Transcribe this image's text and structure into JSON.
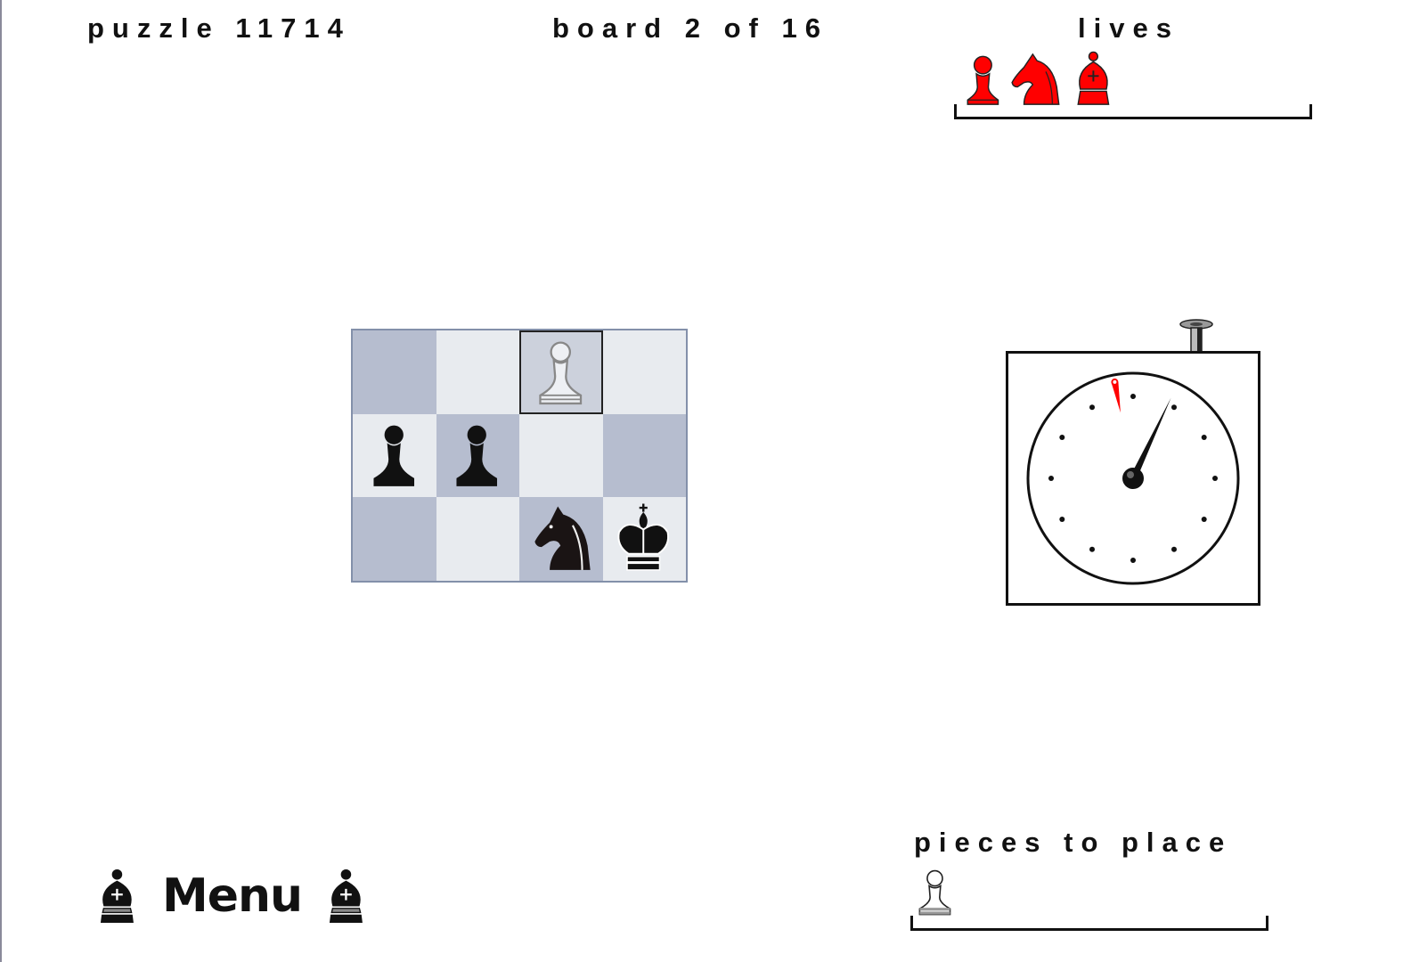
{
  "header": {
    "puzzle_label": "puzzle 11714",
    "board_label": "board 2 of 16",
    "lives_label": "lives"
  },
  "lives": {
    "pieces": [
      "pawn",
      "knight",
      "bishop"
    ],
    "color": "#ff0000"
  },
  "board": {
    "rows": 3,
    "cols": 4,
    "colors": {
      "dark": "#b6bdcf",
      "light": "#e8ebef",
      "border": "#8390aa"
    },
    "selected_square": [
      0,
      2
    ],
    "squares": [
      [
        {
          "shade": "dark",
          "piece": null
        },
        {
          "shade": "light",
          "piece": null
        },
        {
          "shade": "dark",
          "piece": "white-pawn-ghost"
        },
        {
          "shade": "light",
          "piece": null
        }
      ],
      [
        {
          "shade": "light",
          "piece": "black-pawn"
        },
        {
          "shade": "dark",
          "piece": "black-pawn"
        },
        {
          "shade": "light",
          "piece": null
        },
        {
          "shade": "dark",
          "piece": "null"
        }
      ],
      [
        {
          "shade": "dark",
          "piece": null
        },
        {
          "shade": "light",
          "piece": null
        },
        {
          "shade": "dark",
          "piece": "black-knight"
        },
        {
          "shade": "light",
          "piece": "black-king"
        }
      ]
    ]
  },
  "clock": {
    "hand_position_fraction": 0.07,
    "flag_position_fraction": 0.97,
    "flag_color": "#ff0000"
  },
  "menu": {
    "label": "Menu"
  },
  "pieces_to_place": {
    "label": "pieces to place",
    "pieces": [
      "white-pawn"
    ]
  }
}
